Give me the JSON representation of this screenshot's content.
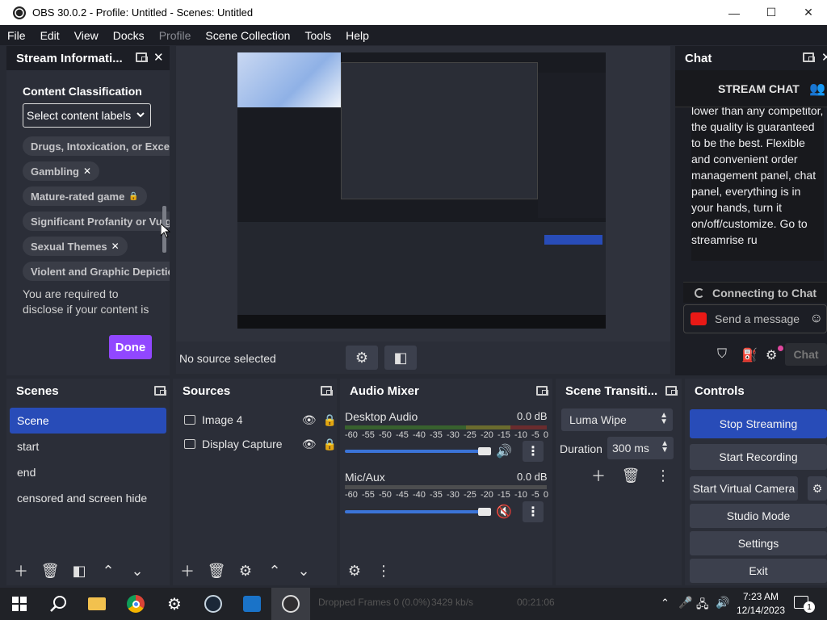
{
  "window": {
    "title": "OBS 30.0.2 - Profile: Untitled - Scenes: Untitled"
  },
  "menu": [
    "File",
    "Edit",
    "View",
    "Docks",
    "Profile",
    "Scene Collection",
    "Tools",
    "Help"
  ],
  "stream_info": {
    "title": "Stream Informati...",
    "section": "Content Classification",
    "select_label": "Select content labels",
    "labels": [
      {
        "text": "Drugs, Intoxication, or Excess",
        "mark": ""
      },
      {
        "text": "Gambling",
        "mark": "✕"
      },
      {
        "text": "Mature-rated game",
        "mark": "🔒"
      },
      {
        "text": "Significant Profanity or Vulga",
        "mark": ""
      },
      {
        "text": "Sexual Themes",
        "mark": "✕"
      },
      {
        "text": "Violent and Graphic Depiction",
        "mark": ""
      }
    ],
    "notice": "You are required to disclose if your content is not suitable for certain",
    "done": "Done"
  },
  "preview": {
    "status": "No source selected"
  },
  "chat": {
    "title": "Chat",
    "header": "STREAM CHAT",
    "message": "lower than any competitor, the quality is guaranteed to be the best. Flexible and convenient order management panel, chat panel, everything is in your hands, turn it on/off/customize. Go to streamrise ru",
    "connecting": "Connecting to Chat",
    "send_placeholder": "Send a message",
    "chat_button": "Chat"
  },
  "scenes": {
    "title": "Scenes",
    "items": [
      "Scene",
      "start",
      "end",
      "censored and screen hide"
    ],
    "active": 0
  },
  "sources": {
    "title": "Sources",
    "items": [
      {
        "name": "Image 4",
        "icon": "image-icon"
      },
      {
        "name": "Display Capture",
        "icon": "monitor-icon"
      }
    ]
  },
  "audio": {
    "title": "Audio Mixer",
    "channels": [
      {
        "name": "Desktop Audio",
        "db": "0.0 dB",
        "muted": false
      },
      {
        "name": "Mic/Aux",
        "db": "0.0 dB",
        "muted": true
      }
    ],
    "ticks": [
      "-60",
      "-55",
      "-50",
      "-45",
      "-40",
      "-35",
      "-30",
      "-25",
      "-20",
      "-15",
      "-10",
      "-5",
      "0"
    ]
  },
  "transitions": {
    "title": "Scene Transiti...",
    "selected": "Luma Wipe",
    "duration_label": "Duration",
    "duration_value": "300 ms"
  },
  "controls": {
    "title": "Controls",
    "buttons": [
      "Stop Streaming",
      "Start Recording",
      "Start Virtual Camera",
      "Studio Mode",
      "Settings",
      "Exit"
    ]
  },
  "status_bar": {
    "frames": "Dropped Frames 0 (0.0%)",
    "bitrate": "3429 kb/s",
    "time": "00:21:06"
  },
  "taskbar": {
    "time": "7:23 AM",
    "date": "12/14/2023",
    "notif_count": "1"
  },
  "colors": {
    "accent": "#284cb8",
    "done": "#9147ff",
    "live_button": "#284cb8"
  }
}
